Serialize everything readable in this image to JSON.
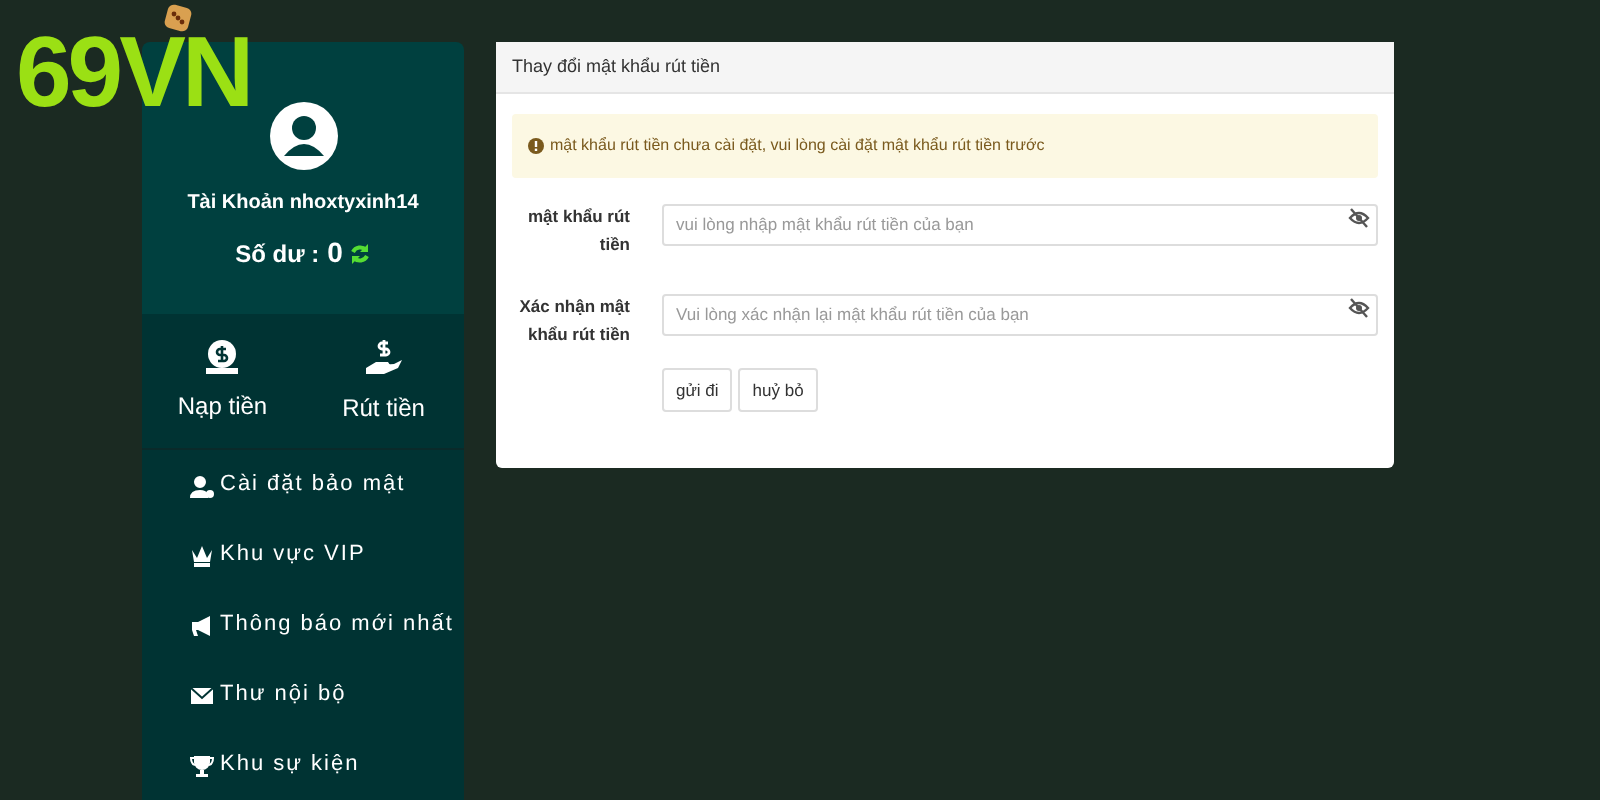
{
  "logo": {
    "text": "69VN"
  },
  "account": {
    "label": "Tài Khoản nhoxtyxinh14",
    "balance_label": "Số dư :",
    "balance": "0"
  },
  "actions": [
    {
      "label": "Nạp tiền"
    },
    {
      "label": "Rút tiền"
    }
  ],
  "menu": [
    {
      "label": "Cài đặt bảo mật"
    },
    {
      "label": "Khu vực VIP"
    },
    {
      "label": "Thông báo mới nhất"
    },
    {
      "label": "Thư nội bộ"
    },
    {
      "label": "Khu sự kiện"
    }
  ],
  "panel": {
    "title": "Thay đổi mật khẩu rút tiền",
    "alert": "mật khẩu rút tiền chưa cài đặt, vui lòng cài đặt mật khẩu rút tiền trước",
    "fields": [
      {
        "label": "mật khẩu rút tiền",
        "placeholder": "vui lòng nhập mật khẩu rút tiền của bạn"
      },
      {
        "label": "Xác nhận mật khẩu rút tiền",
        "placeholder": "Vui lòng xác nhận lại mật khẩu rút tiền của bạn"
      }
    ],
    "buttons": [
      "gửi đi",
      "huỷ bỏ"
    ]
  }
}
